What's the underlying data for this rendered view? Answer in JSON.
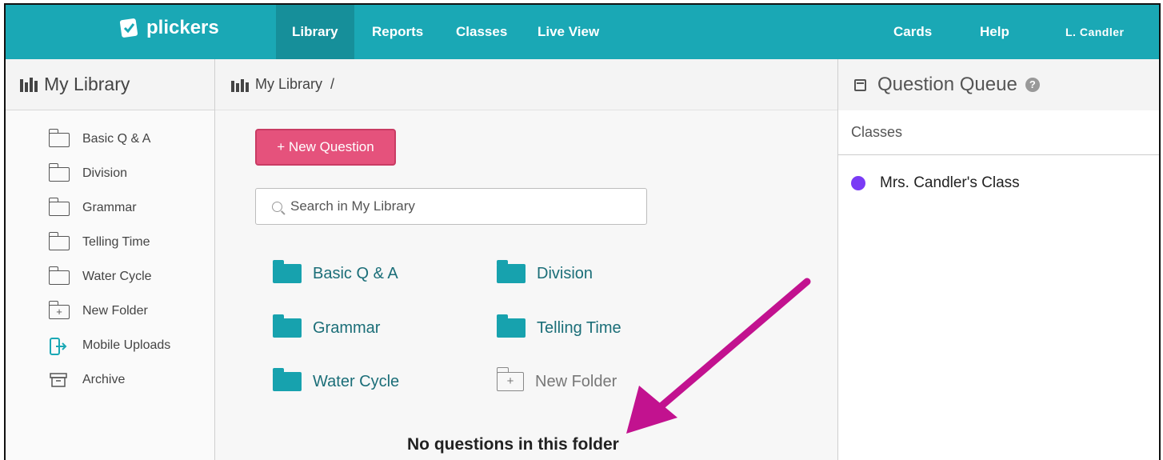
{
  "app": {
    "logo_text": "plickers",
    "nav": [
      "Library",
      "Reports",
      "Classes",
      "Live View"
    ],
    "nav_right": [
      "Cards",
      "Help",
      "L. Candler"
    ],
    "colors": {
      "topbar": "#1aa8b5",
      "active_nav": "#168f9a",
      "accent": "#e5527c",
      "folder": "#17a2ae",
      "class_dot": "#7a3bf5",
      "arrow": "#c2128f"
    }
  },
  "sidebar": {
    "title": "My Library",
    "items": [
      {
        "label": "Basic Q & A",
        "icon": "folder-icon"
      },
      {
        "label": "Division",
        "icon": "folder-icon"
      },
      {
        "label": "Grammar",
        "icon": "folder-icon"
      },
      {
        "label": "Telling Time",
        "icon": "folder-icon"
      },
      {
        "label": "Water Cycle",
        "icon": "folder-icon"
      },
      {
        "label": "New Folder",
        "icon": "new-folder-icon"
      },
      {
        "label": "Mobile Uploads",
        "icon": "mobile-upload-icon"
      },
      {
        "label": "Archive",
        "icon": "archive-icon"
      }
    ]
  },
  "main": {
    "breadcrumb": "My Library",
    "breadcrumb_sep": "/",
    "new_question_label": "+ New Question",
    "search_placeholder": "Search in My Library",
    "folders": [
      "Basic Q & A",
      "Division",
      "Grammar",
      "Telling Time",
      "Water Cycle"
    ],
    "new_folder_label": "New Folder",
    "empty_message": "No questions in this folder"
  },
  "queue": {
    "title": "Question Queue",
    "help_glyph": "?",
    "classes_label": "Classes",
    "classes": [
      "Mrs. Candler's Class"
    ]
  }
}
